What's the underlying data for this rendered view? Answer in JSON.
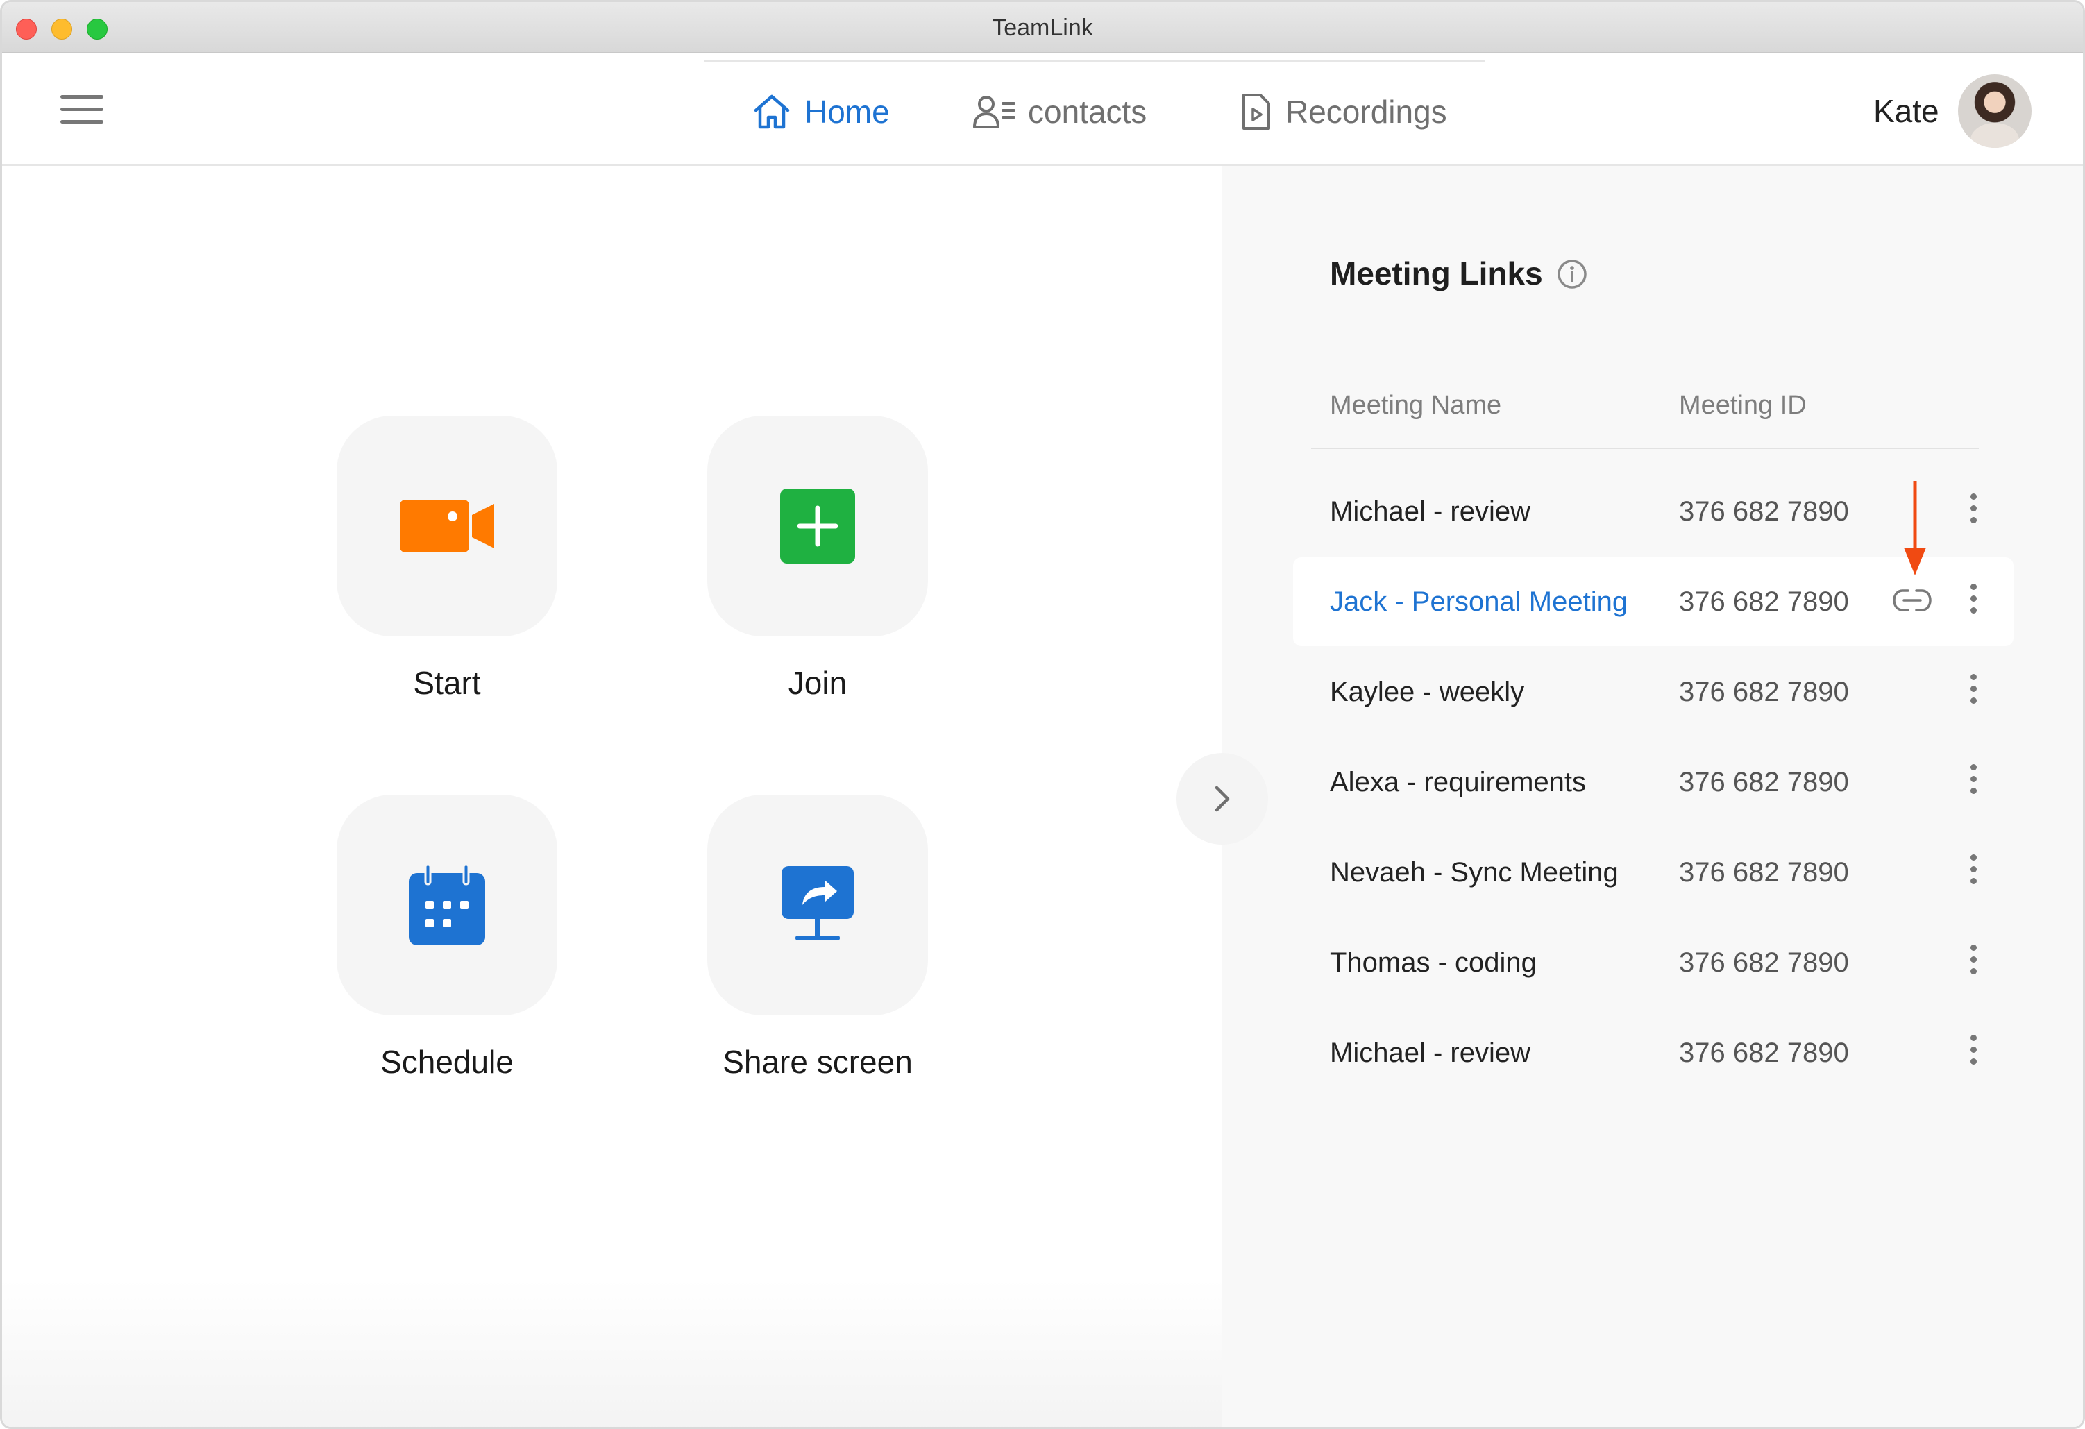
{
  "window": {
    "title": "TeamLink"
  },
  "nav": {
    "tabs": [
      {
        "label": "Home",
        "icon": "home-icon",
        "active": true
      },
      {
        "label": "contacts",
        "icon": "contacts-icon",
        "active": false
      },
      {
        "label": "Recordings",
        "icon": "recordings-icon",
        "active": false
      }
    ],
    "user": {
      "name": "Kate"
    }
  },
  "actions": [
    {
      "label": "Start",
      "icon": "video-camera-icon",
      "color": "#ff7a00"
    },
    {
      "label": "Join",
      "icon": "plus-icon",
      "color": "#1fb141"
    },
    {
      "label": "Schedule",
      "icon": "calendar-icon",
      "color": "#1e73d2"
    },
    {
      "label": "Share screen",
      "icon": "share-screen-icon",
      "color": "#1e73d2"
    }
  ],
  "meeting_links": {
    "title": "Meeting Links",
    "columns": {
      "name": "Meeting Name",
      "id": "Meeting ID"
    },
    "rows": [
      {
        "name": "Michael - review",
        "id": "376 682 7890"
      },
      {
        "name": "Jack - Personal Meeting",
        "id": "376 682 7890"
      },
      {
        "name": "Kaylee - weekly",
        "id": "376 682 7890"
      },
      {
        "name": "Alexa - requirements",
        "id": "376 682 7890"
      },
      {
        "name": "Nevaeh - Sync Meeting",
        "id": "376 682 7890"
      },
      {
        "name": "Thomas - coding",
        "id": "376 682 7890"
      },
      {
        "name": "Michael - review",
        "id": "376 682 7890"
      }
    ],
    "highlighted_row": 1
  },
  "colors": {
    "accent": "#1e73d2",
    "annotation_arrow": "#f04a12"
  }
}
